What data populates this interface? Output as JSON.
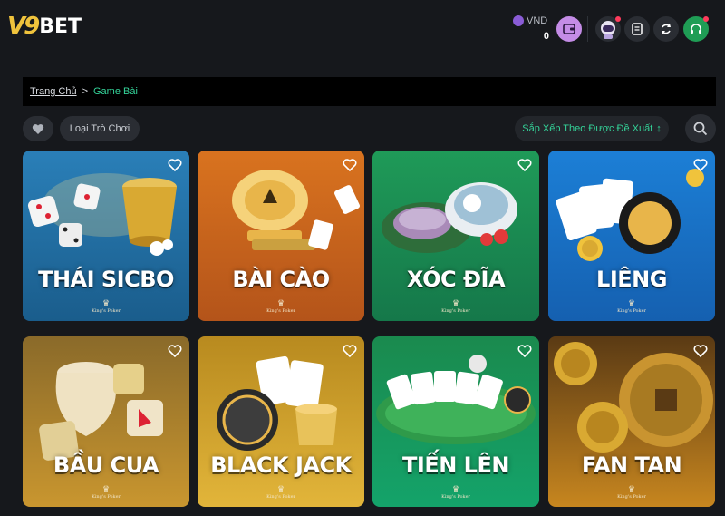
{
  "header": {
    "logo_num": "V9",
    "logo_text": "BET",
    "currency": "VND",
    "balance": "0"
  },
  "breadcrumb": {
    "home": "Trang Chủ",
    "separator": ">",
    "current": "Game Bài"
  },
  "filters": {
    "game_type_label": "Loại Trò Chơi",
    "sort_label": "Sắp Xếp Theo Được Đề Xuất",
    "sort_arrow": "↕"
  },
  "games": [
    {
      "title": "THÁI SICBO",
      "brand": "King's Poker"
    },
    {
      "title": "BÀI CÀO",
      "brand": "King's Poker"
    },
    {
      "title": "XÓC ĐĨA",
      "brand": "King's Poker"
    },
    {
      "title": "LIÊNG",
      "brand": "King's Poker"
    },
    {
      "title": "BẦU CUA",
      "brand": "King's Poker"
    },
    {
      "title": "BLACK JACK",
      "brand": "King's Poker"
    },
    {
      "title": "TIẾN LÊN",
      "brand": "King's Poker"
    },
    {
      "title": "FAN TAN",
      "brand": "King's Poker"
    }
  ],
  "colors": {
    "accent_green": "#34d399",
    "wallet_purple": "#c48ce6",
    "support_green": "#1f9d55",
    "notification_red": "#ff3b5c"
  },
  "icons": {
    "wallet": "wallet-icon",
    "avatar": "astronaut-avatar-icon",
    "notes": "notepad-icon",
    "refresh": "refresh-icon",
    "support": "headset-icon",
    "favorite": "heart-icon",
    "search": "search-icon"
  }
}
